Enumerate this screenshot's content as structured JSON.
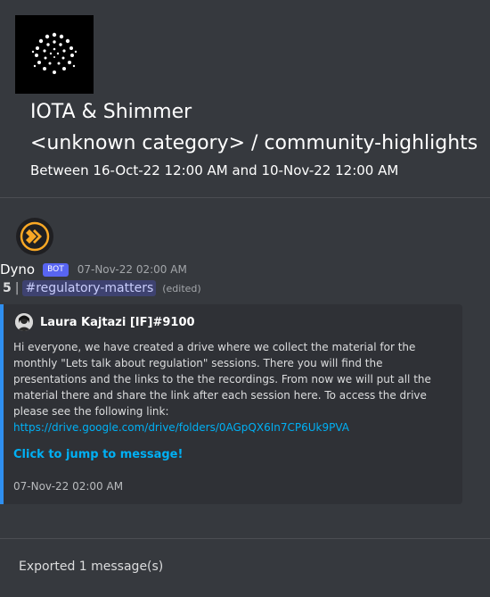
{
  "guild": {
    "name": "IOTA & Shimmer",
    "icon": "iota-logo-icon"
  },
  "channel": {
    "path": "<unknown category> / community-highlights"
  },
  "date_range": "Between 16-Oct-22 12:00 AM and 10-Nov-22 12:00 AM",
  "message": {
    "author": "Dyno",
    "bot_tag": "BOT",
    "timestamp": "07-Nov-22 02:00 AM",
    "avatar_icon": "dyno-logo-icon",
    "count": "5",
    "separator": "|",
    "mention": "#regulatory-matters",
    "edited": "(edited)"
  },
  "quote": {
    "author": "Laura Kajtazi [IF]#9100",
    "text": "Hi everyone, we have created a drive where we collect the material for the monthly \"Lets talk about regulation\" sessions. There you will find the presentations and the links to the the recordings. From now we will put all the material there and share the link after each session here. To access the drive please see the following link:",
    "link": "https://drive.google.com/drive/folders/0AGpQX6In7CP6Uk9PVA",
    "jump_label": "Click to jump to message!",
    "timestamp": "07-Nov-22 02:00 AM",
    "accent_color": "#2f8ff0"
  },
  "footer": "Exported 1 message(s)",
  "colors": {
    "background": "#36393e",
    "card": "#2f3136",
    "bot_tag": "#5865f2",
    "link": "#00b0f4"
  }
}
